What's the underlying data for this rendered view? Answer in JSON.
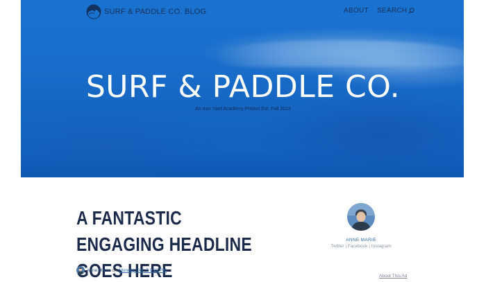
{
  "header": {
    "logo_text": "SURF & PADDLE CO. BLOG",
    "logo_icon": "wave-logo-icon",
    "nav": {
      "about_label": "ABOUT",
      "search_label": "SEARCH",
      "search_icon": "search-icon"
    }
  },
  "hero": {
    "title": "SURF & PADDLE CO.",
    "subtitle": "An Iron Yard Academy Project Est. Fall 2013"
  },
  "post": {
    "headline": "A FANTASTIC ENGAGING HEADLINE GOES HERE",
    "byline": {
      "author": "Anne Marie",
      "on_text": "on",
      "date": "Monday Oct. 7 9:22 PM"
    }
  },
  "sidebar": {
    "author_name": "ANNE MARIE",
    "social": [
      "Twitter",
      "Facebook",
      "Instagram"
    ],
    "separator": "|"
  },
  "ad": {
    "label": "About This Ad"
  },
  "colors": {
    "hero_blue": "#1a6fcc",
    "headline_navy": "#1b2a4a",
    "link_blue": "#2b6bb0"
  }
}
